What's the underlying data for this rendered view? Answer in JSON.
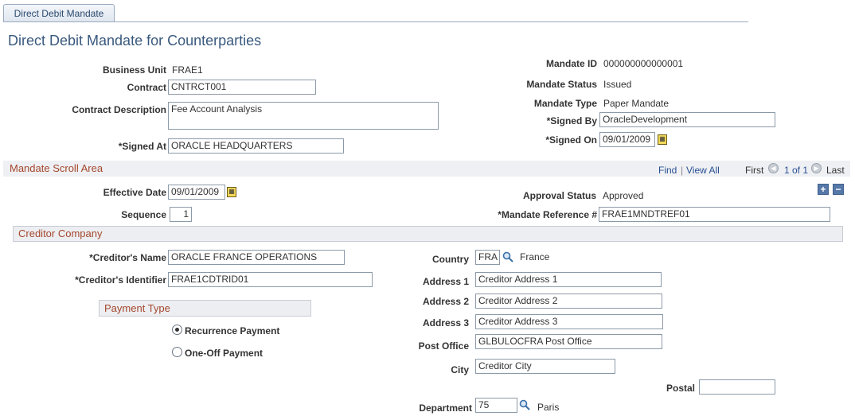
{
  "tab": {
    "label": "Direct Debit Mandate"
  },
  "page": {
    "title": "Direct Debit Mandate for Counterparties"
  },
  "header": {
    "business_unit_label": "Business Unit",
    "business_unit": "FRAE1",
    "contract_label": "Contract",
    "contract": "CNTRCT001",
    "contract_description_label": "Contract Description",
    "contract_description": "Fee Account Analysis",
    "signed_at_label": "*Signed At",
    "signed_at": "ORACLE HEADQUARTERS",
    "mandate_id_label": "Mandate ID",
    "mandate_id": "000000000000001",
    "mandate_status_label": "Mandate Status",
    "mandate_status": "Issued",
    "mandate_type_label": "Mandate Type",
    "mandate_type": "Paper Mandate",
    "signed_by_label": "*Signed By",
    "signed_by": "OracleDevelopment",
    "signed_on_label": "*Signed On",
    "signed_on": "09/01/2009"
  },
  "scroll": {
    "title": "Mandate Scroll Area",
    "find": "Find",
    "separator": "|",
    "view_all": "View All",
    "first": "First",
    "position": "1 of 1",
    "last": "Last",
    "effective_date_label": "Effective Date",
    "effective_date": "09/01/2009",
    "sequence_label": "Sequence",
    "sequence": "1",
    "approval_status_label": "Approval Status",
    "approval_status": "Approved",
    "mandate_reference_label": "*Mandate Reference #",
    "mandate_reference": "FRAE1MNDTREF01"
  },
  "creditor": {
    "section_title": "Creditor Company",
    "name_label": "*Creditor's Name",
    "name": "ORACLE FRANCE OPERATIONS",
    "identifier_label": "*Creditor's Identifier",
    "identifier": "FRAE1CDTRID01",
    "country_label": "Country",
    "country_code": "FRA",
    "country_name": "France",
    "address1_label": "Address 1",
    "address1": "Creditor Address 1",
    "address2_label": "Address 2",
    "address2": "Creditor Address 2",
    "address3_label": "Address 3",
    "address3": "Creditor Address 3",
    "post_office_label": "Post Office",
    "post_office": "GLBULOCFRA Post Office",
    "city_label": "City",
    "city": "Creditor City",
    "postal_label": "Postal",
    "postal": "",
    "department_label": "Department",
    "department": "75",
    "department_name": "Paris"
  },
  "payment_type": {
    "title": "Payment Type",
    "options": [
      "Recurrence Payment",
      "One-Off Payment"
    ],
    "selected": "Recurrence Payment"
  },
  "icons": {
    "calendar": "calendar-icon",
    "lookup": "magnifier-icon",
    "add": "plus",
    "delete": "minus"
  },
  "colors": {
    "title_blue": "#39597e",
    "section_red": "#a5472e",
    "link_blue": "#2a4f92"
  }
}
